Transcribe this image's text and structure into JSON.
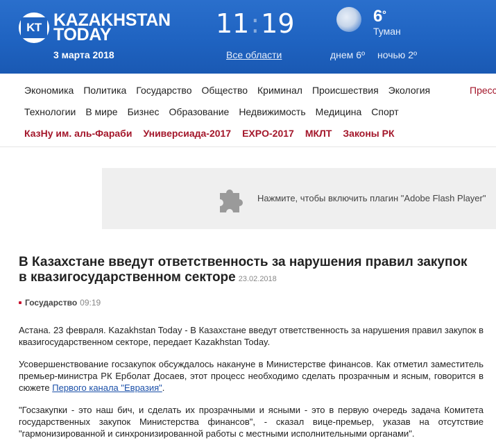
{
  "header": {
    "logo_mark": "KT",
    "logo_line1": "KAZAKHSTAN",
    "logo_line2": "TODAY",
    "date": "3 марта 2018",
    "clock_hours": "11",
    "clock_colon": ":",
    "clock_minutes": "19",
    "regions_link": "Все области",
    "weather": {
      "icon": "fog-icon",
      "temp_value": "6",
      "temp_unit": "º",
      "condition": "Туман",
      "day": "днем 6º",
      "night": "ночью 2º"
    },
    "colors": {
      "background": "#1f63c1",
      "accent_red": "#a3162a"
    }
  },
  "nav": {
    "row1": [
      "Экономика",
      "Политика",
      "Государство",
      "Общество",
      "Криминал",
      "Происшествия",
      "Экология"
    ],
    "press": "Пресс",
    "row2": [
      "Технологии",
      "В мире",
      "Бизнес",
      "Образование",
      "Недвижимость",
      "Медицина",
      "Спорт"
    ],
    "row3": [
      "КазНу им. аль-Фараби",
      "Универсиада-2017",
      "EXPO-2017",
      "МКЛТ",
      "Законы РК"
    ]
  },
  "flash": {
    "icon": "puzzle-plugin-icon",
    "text": "Нажмите, чтобы включить плагин \"Adobe Flash Player\""
  },
  "article": {
    "title": "В Казахстане введут ответственность за нарушения правил закупок в квазигосударственном секторе",
    "title_date": "23.02.2018",
    "category": "Государство",
    "time": "09:19",
    "p1": "Астана. 23 февраля. Kazakhstan Today - В Казахстане введут ответственность за нарушения правил закупок в квазигосударственном секторе, передает Kazakhstan Today.",
    "p2_before": "Усовершенствование госзакупок обсуждалось накануне в Министерстве финансов. Как отметил заместитель премьер-министра РК Ерболат Досаев, этот процесс необходимо сделать прозрачным и ясным, говорится в сюжете ",
    "p2_link": "Первого канала \"Евразия\"",
    "p2_after": ".",
    "p3": "\"Госзакупки - это наш бич, и сделать их прозрачными и ясными - это в первую очередь задача Комитета государственных закупок Министерства финансов\", - сказал вице-премьер, указав на отсутствие \"гармонизированной и синхронизированной работы с местными исполнительными органами\"."
  }
}
